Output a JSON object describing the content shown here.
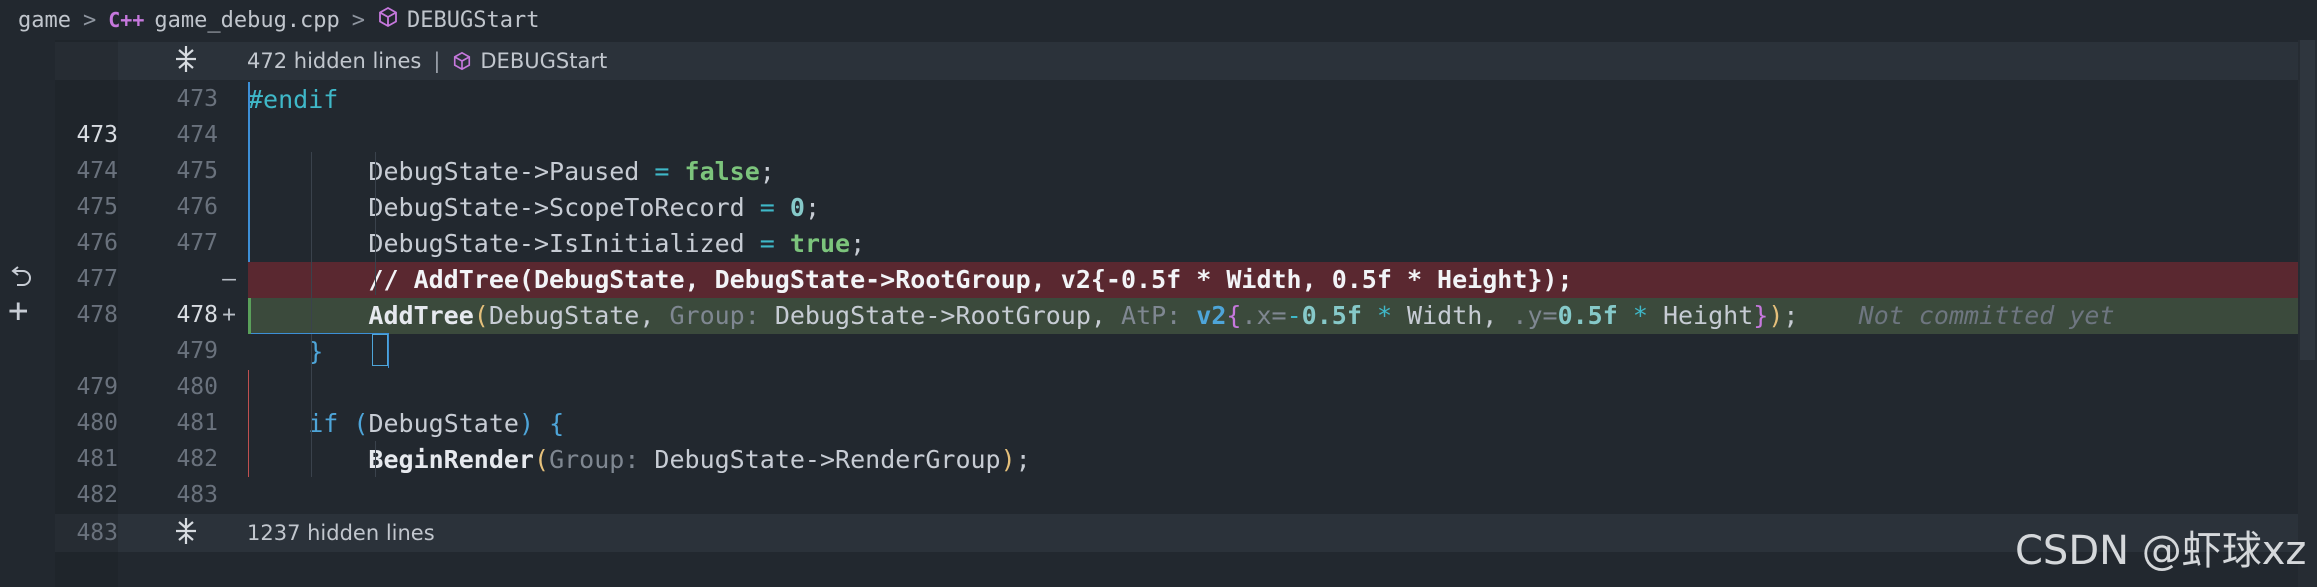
{
  "breadcrumb": {
    "root": "game",
    "file_icon": "C++",
    "file": "game_debug.cpp",
    "symbol": "DEBUGStart"
  },
  "folds": {
    "top": {
      "text": "472 hidden lines",
      "symbol": "DEBUGStart"
    },
    "bottom": {
      "text": "1237 hidden lines"
    }
  },
  "lines": [
    {
      "old": "",
      "new": "473"
    },
    {
      "old": "473",
      "new": "474"
    },
    {
      "old": "474",
      "new": "475"
    },
    {
      "old": "475",
      "new": "476"
    },
    {
      "old": "476",
      "new": "477"
    },
    {
      "old": "477",
      "new": "",
      "mark": "—"
    },
    {
      "old": "478",
      "new": "478",
      "mark": "+"
    },
    {
      "old": "",
      "new": "479"
    },
    {
      "old": "479",
      "new": "480"
    },
    {
      "old": "480",
      "new": "481"
    },
    {
      "old": "481",
      "new": "482"
    },
    {
      "old": "482",
      "new": "483"
    },
    {
      "old": "483",
      "new": ""
    }
  ],
  "code": {
    "l1": "#endif",
    "l3_a": "DebugState->Paused ",
    "l3_op": "=",
    "l3_val": "false",
    "l3_end": ";",
    "l4_a": "DebugState->ScopeToRecord ",
    "l4_op": "=",
    "l4_val": "0",
    "l4_end": ";",
    "l5_a": "DebugState->IsInitialized ",
    "l5_op": "=",
    "l5_val": "true",
    "l5_end": ";",
    "removed": "// AddTree(DebugState, DebugState->RootGroup, v2{-0.5f * Width, 0.5f * Height});",
    "added_fn": "AddTree",
    "added_arg1": "DebugState, ",
    "added_hint1": "Group: ",
    "added_arg2": "DebugState->RootGroup, ",
    "added_hint2": "AtP: ",
    "added_type": "v2",
    "added_x": ".x=",
    "added_neg": "-",
    "added_n1": "0.5f",
    "added_mul1": " * ",
    "added_w": "Width, ",
    "added_y": ".y=",
    "added_n2": "0.5f",
    "added_mul2": " * ",
    "added_h": "Height",
    "added_end": ";",
    "blame": "Not committed yet",
    "close_brace": "}",
    "if_kw": "if",
    "if_cond": "DebugState",
    "begin_fn": "BeginRender",
    "begin_hint": "Group: ",
    "begin_arg": "DebugState->RenderGroup",
    "begin_end": ";"
  },
  "watermark": "CSDN @虾球xz"
}
